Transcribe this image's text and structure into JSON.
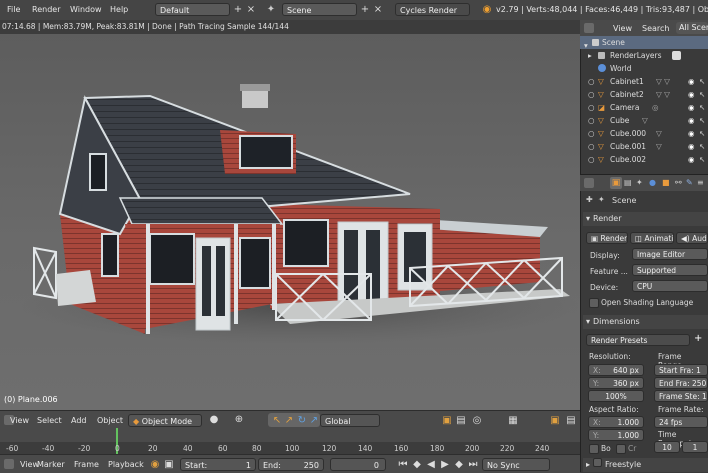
{
  "menu": [
    "File",
    "Render",
    "Window",
    "Help"
  ],
  "layout_field": "Default",
  "scene_field": "Scene",
  "engine": "Cycles Render",
  "stats": "v2.79 | Verts:48,044 | Faces:46,449 | Tris:93,487 | Objects:",
  "status": "07:14.68 | Mem:83.79M, Peak:83.81M | Done | Path Tracing Sample 144/144",
  "viewport": {
    "object_label": "(0) Plane.006"
  },
  "view_header": {
    "items": [
      "View",
      "Select",
      "Add",
      "Object"
    ],
    "mode": "Object Mode",
    "orientation": "Global"
  },
  "timeline": {
    "ticks": [
      "-60",
      "-40",
      "-20",
      "0",
      "20",
      "40",
      "60",
      "80",
      "100",
      "120",
      "140",
      "160",
      "180",
      "200",
      "220",
      "240"
    ],
    "items": [
      "View",
      "Marker",
      "Frame",
      "Playback"
    ],
    "start_label": "Start:",
    "start_value": "1",
    "end_label": "End:",
    "end_value": "250",
    "current_frame": "0",
    "sync": "No Sync"
  },
  "outliner": {
    "tabs": [
      "View",
      "Search",
      "All Scenes"
    ],
    "rows": [
      {
        "label": "Scene",
        "icon_color": "#cccccc",
        "selected": true
      },
      {
        "label": "RenderLayers",
        "icon_color": "#bbbbbb"
      },
      {
        "label": "World",
        "icon_color": "#5b8fd8"
      },
      {
        "label": "Cabinet1",
        "icon_color": "#e89a3c"
      },
      {
        "label": "Cabinet2",
        "icon_color": "#e89a3c"
      },
      {
        "label": "Camera",
        "icon_color": "#e89a3c"
      },
      {
        "label": "Cube",
        "icon_color": "#e89a3c"
      },
      {
        "label": "Cube.000",
        "icon_color": "#e89a3c"
      },
      {
        "label": "Cube.001",
        "icon_color": "#e89a3c"
      },
      {
        "label": "Cube.002",
        "icon_color": "#e89a3c"
      }
    ]
  },
  "properties": {
    "breadcrumb": "Scene",
    "render_panel": "Render",
    "render_buttons": [
      "Render",
      "Animatio",
      "Audio"
    ],
    "display_label": "Display:",
    "display_value": "Image Editor",
    "feature_label": "Feature ...",
    "feature_value": "Supported",
    "device_label": "Device:",
    "device_value": "CPU",
    "osl_label": "Open Shading Language",
    "dimensions_panel": "Dimensions",
    "presets": "Render Presets",
    "resolution_label": "Resolution:",
    "res_x": "640 px",
    "res_y": "360 px",
    "res_pct": "100%",
    "frame_range_label": "Frame Range:",
    "start_frame": "Start Fra: 1",
    "end_frame": "End Fra: 250",
    "frame_step": "Frame Ste: 1",
    "aspect_label": "Aspect Ratio:",
    "aspect_x": "1.000",
    "aspect_y": "1.000",
    "frame_rate_label": "Frame Rate:",
    "fps": "24 fps",
    "time_remap": "Time Remappi",
    "time_old": "10",
    "time_new": "1",
    "bo_label": "Bo",
    "cr_label": "Cr",
    "freestyle_panel": "Freestyle",
    "x_label": "X:",
    "y_label": "Y:"
  },
  "colors": {
    "wall": "#a8473c",
    "roof": "#3b3f46",
    "trim": "#d7dde0",
    "accent_blue": "#5b6a80",
    "object_orange": "#e89a3c"
  }
}
